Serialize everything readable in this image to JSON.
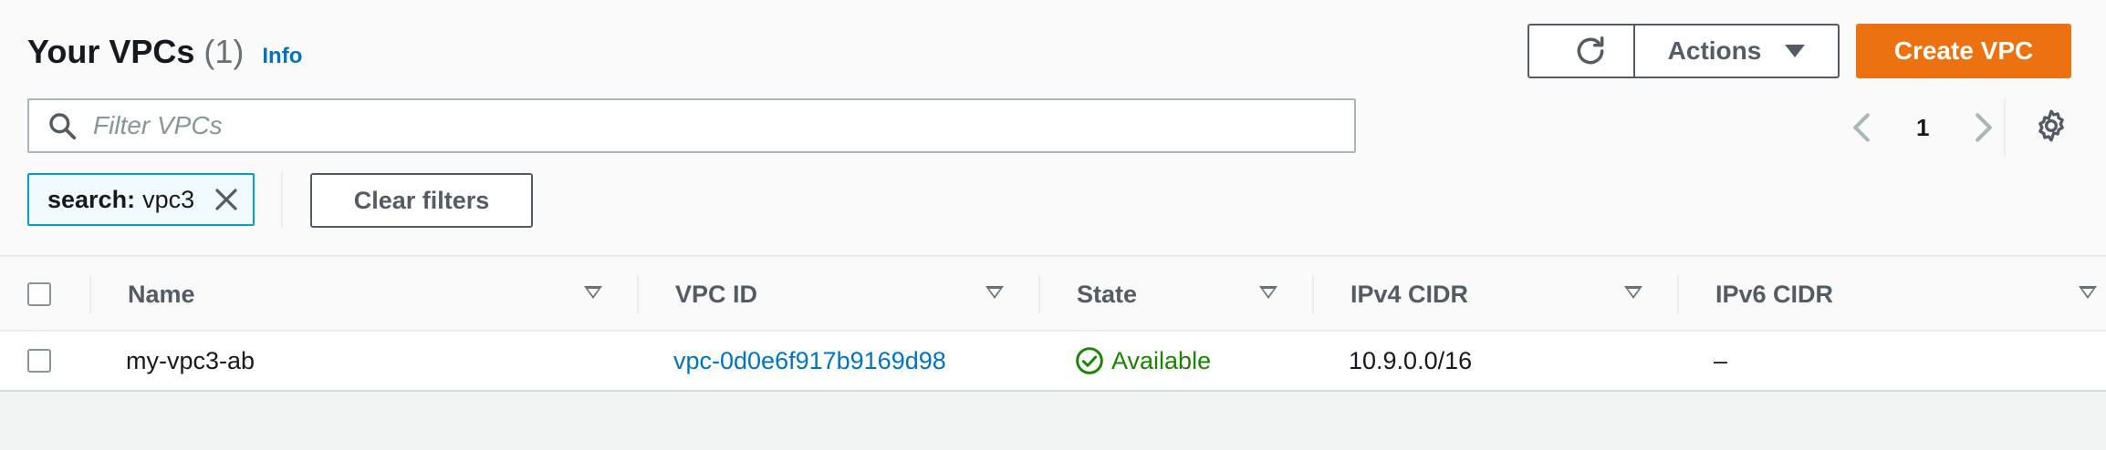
{
  "header": {
    "title": "Your VPCs",
    "count": "(1)",
    "info_label": "Info"
  },
  "toolbar": {
    "refresh_icon": "refresh-icon",
    "actions_label": "Actions",
    "create_label": "Create VPC",
    "create_color": "#ec7211"
  },
  "search": {
    "placeholder": "Filter VPCs",
    "value": ""
  },
  "pagination": {
    "current_page": "1"
  },
  "filter_token": {
    "key": "search:",
    "value": "vpc3"
  },
  "clear_filters_label": "Clear filters",
  "table": {
    "columns": [
      "Name",
      "VPC ID",
      "State",
      "IPv4 CIDR",
      "IPv6 CIDR"
    ],
    "rows": [
      {
        "name": "my-vpc3-ab",
        "vpc_id": "vpc-0d0e6f917b9169d98",
        "state": "Available",
        "ipv4": "10.9.0.0/16",
        "ipv6": "–"
      }
    ]
  },
  "colors": {
    "link": "#0073bb",
    "status_ok": "#1d8102",
    "token_border": "#00a1c9"
  }
}
